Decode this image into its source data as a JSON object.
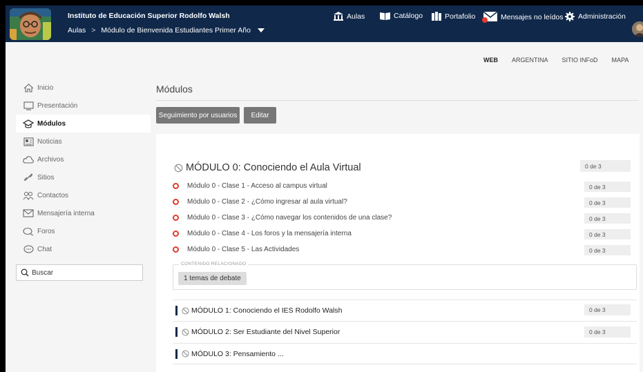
{
  "header": {
    "institution": "Instituto de Educación Superior Rodolfo Walsh",
    "breadcrumb": {
      "root": "Aulas",
      "separator": ">",
      "current": "Módulo de Bienvenida Estudiantes Primer Año"
    },
    "nav": [
      {
        "label": "Aulas",
        "icon": "classroom-icon"
      },
      {
        "label": "Catálogo",
        "icon": "book-icon"
      },
      {
        "label": "Portafolio",
        "icon": "portfolio-icon"
      },
      {
        "label": "Mensajes no leídos",
        "icon": "envelope-icon"
      },
      {
        "label": "Administración",
        "icon": "gear-icon"
      }
    ]
  },
  "secondary_links": [
    "WEB",
    "ARGENTINA",
    "SITIO INFoD",
    "MAPA"
  ],
  "sidebar": {
    "items": [
      {
        "label": "Inicio",
        "icon": "home-icon"
      },
      {
        "label": "Presentación",
        "icon": "monitor-icon"
      },
      {
        "label": "Módulos",
        "icon": "graduation-cap-icon"
      },
      {
        "label": "Noticias",
        "icon": "newspaper-icon"
      },
      {
        "label": "Archivos",
        "icon": "cloud-icon"
      },
      {
        "label": "Sitios",
        "icon": "link-icon"
      },
      {
        "label": "Contactos",
        "icon": "contacts-icon"
      },
      {
        "label": "Mensajería interna",
        "icon": "envelope-icon"
      },
      {
        "label": "Foros",
        "icon": "forum-icon"
      },
      {
        "label": "Chat",
        "icon": "chat-icon"
      }
    ],
    "search_label": "Buscar"
  },
  "main": {
    "title": "Módulos",
    "buttons": {
      "tracking": "Seguimiento por usuarios",
      "edit": "Editar"
    },
    "module0": {
      "title": "MÓDULO 0: Conociendo el Aula Virtual",
      "count": "0 de 3",
      "lessons": [
        {
          "label": "Módulo 0 - Clase 1 - Acceso al campus virtual",
          "count": "0 de 3"
        },
        {
          "label": "Módulo 0 - Clase 2 - ¿Cómo ingresar al aula virtual?",
          "count": "0 de 3"
        },
        {
          "label": "Módulo 0 - Clase 3 - ¿Cómo navegar los contenidos de una clase?",
          "count": "0 de 3"
        },
        {
          "label": "Módulo 0 - Clase 4 - Los foros y la mensajería interna",
          "count": "0 de 3"
        },
        {
          "label": "Módulo 0 - Clase 5 - Las Actividades",
          "count": "0 de 3"
        }
      ],
      "related_label": "CONTENIDO RELACIONADO",
      "related_button": "1 temas de debate"
    },
    "modules": [
      {
        "title": "MÓDULO 1: Conociendo el IES Rodolfo Walsh",
        "count": "0 de 3"
      },
      {
        "title": "MÓDULO 2: Ser Estudiante del Nivel Superior",
        "count": "0 de 3"
      },
      {
        "title": "MÓDULO 3: Pensamiento ..."
      }
    ]
  },
  "colors": {
    "header_bg": "#10284a",
    "accent_ring": "#e03a2e",
    "button_bg": "#777777",
    "notification": "#e8392e"
  }
}
